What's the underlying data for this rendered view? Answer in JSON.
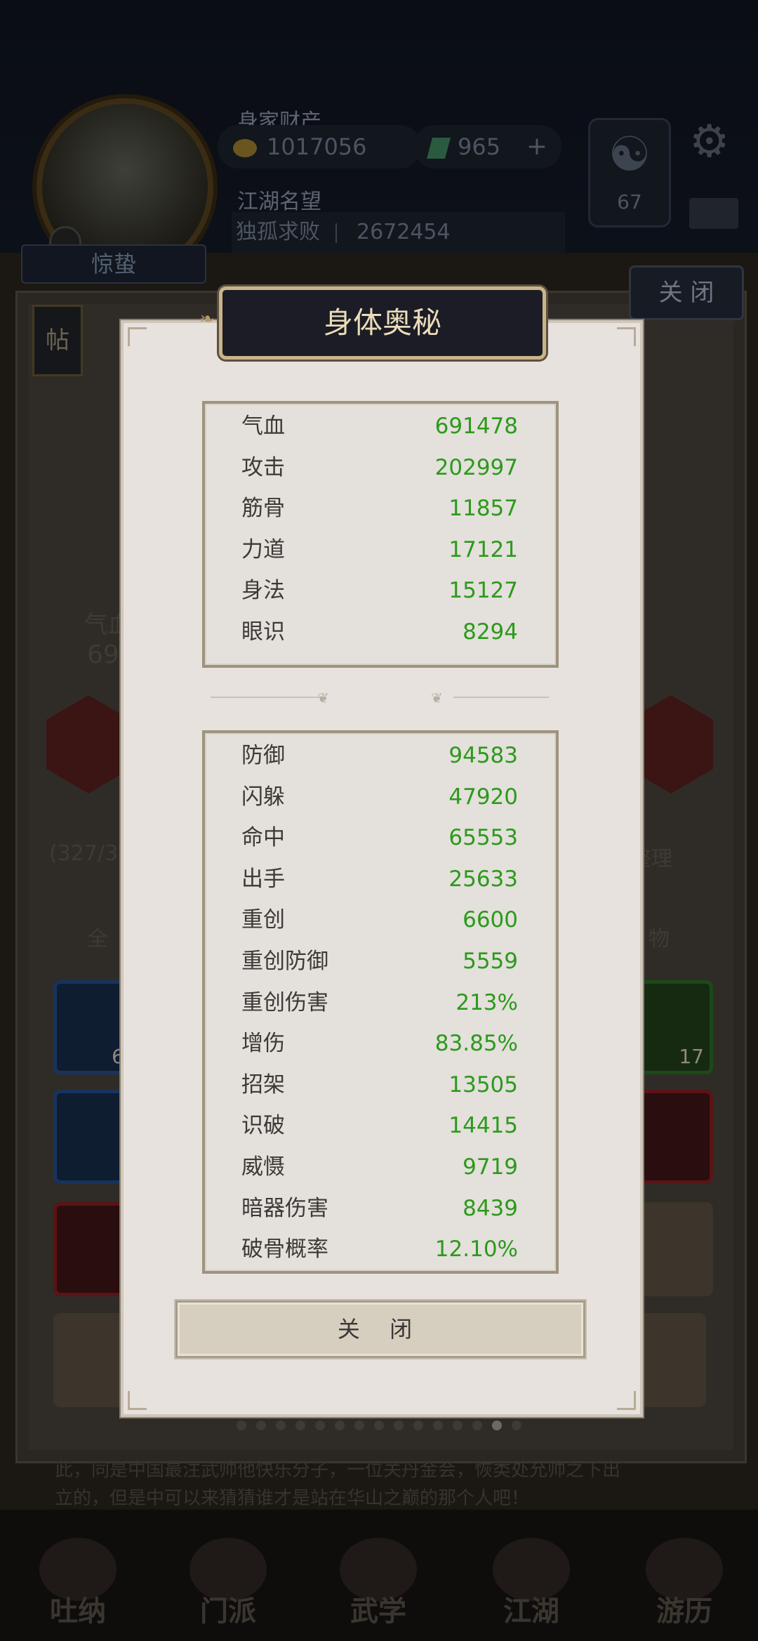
{
  "header": {
    "wealth_label": "身家财产",
    "coins": "1017056",
    "gems": "965",
    "plus": "+",
    "fame_label": "江湖名望",
    "fame_title": "独孤求败",
    "fame_value": "2672454",
    "level": "67",
    "nickname": "惊蛰"
  },
  "background": {
    "close_label": "关 闭",
    "tie_label": "帖",
    "partial_stat_label": "气血",
    "partial_stat_value": "691",
    "bag_count": "(327/36",
    "organize_label": "整理",
    "tab_all": "全",
    "tab_items": "物",
    "item_count": "17",
    "partial_count": "6",
    "scroll_text_1": "此，同是中国最注武帅他快乐分子，一位关丹金会，恢类处允帅之下出",
    "scroll_text_2": "立的，但是中可以来猜猜谁才是站在华山之巅的那个人吧！"
  },
  "tabs": [
    {
      "label": "吐纳"
    },
    {
      "label": "门派"
    },
    {
      "label": "武学"
    },
    {
      "label": "江湖"
    },
    {
      "label": "游历"
    }
  ],
  "modal": {
    "title": "身体奥秘",
    "stats_basic": [
      {
        "name": "气血",
        "value": "691478"
      },
      {
        "name": "攻击",
        "value": "202997"
      },
      {
        "name": "筋骨",
        "value": "11857"
      },
      {
        "name": "力道",
        "value": "17121"
      },
      {
        "name": "身法",
        "value": "15127"
      },
      {
        "name": "眼识",
        "value": "8294"
      }
    ],
    "stats_advanced": [
      {
        "name": "防御",
        "value": "94583"
      },
      {
        "name": "闪躲",
        "value": "47920"
      },
      {
        "name": "命中",
        "value": "65553"
      },
      {
        "name": "出手",
        "value": "25633"
      },
      {
        "name": "重创",
        "value": "6600"
      },
      {
        "name": "重创防御",
        "value": "5559"
      },
      {
        "name": "重创伤害",
        "value": "213%"
      },
      {
        "name": "增伤",
        "value": "83.85%"
      },
      {
        "name": "招架",
        "value": "13505"
      },
      {
        "name": "识破",
        "value": "14415"
      },
      {
        "name": "威慑",
        "value": "9719"
      },
      {
        "name": "暗器伤害",
        "value": "8439"
      },
      {
        "name": "破骨概率",
        "value": "12.10%"
      }
    ],
    "close_label": "关 闭"
  },
  "colors": {
    "stat_value": "#2c9a1c",
    "title_text": "#eadcb8"
  }
}
